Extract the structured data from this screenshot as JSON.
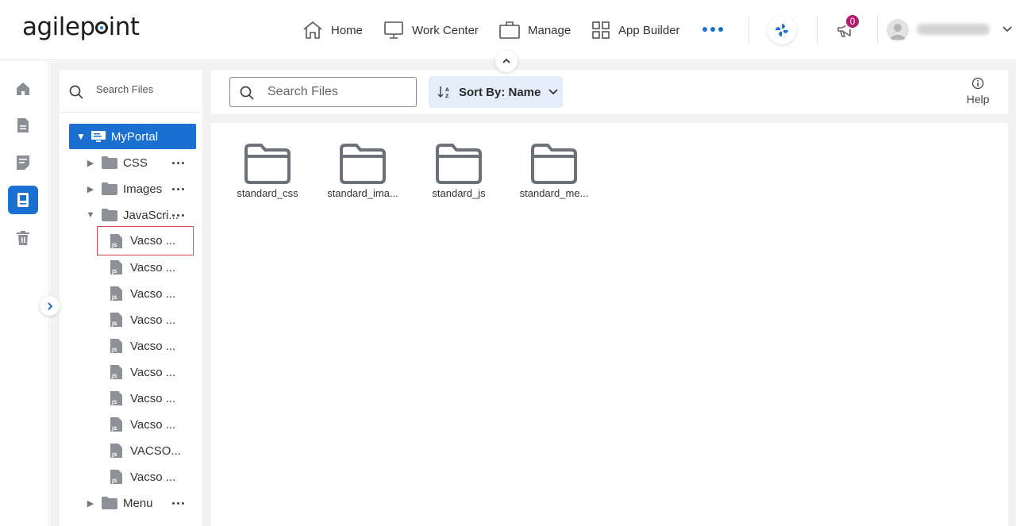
{
  "brand": {
    "logo_prefix": "agilep",
    "logo_suffix": "int"
  },
  "nav": {
    "home": "Home",
    "work_center": "Work Center",
    "manage": "Manage",
    "app_builder": "App Builder"
  },
  "notifications": {
    "count": "0"
  },
  "tree": {
    "search_placeholder": "Search Files",
    "root": "MyPortal",
    "folders": {
      "css": "CSS",
      "images": "Images",
      "javascript": "JavaScri...",
      "menu": "Menu"
    },
    "files": [
      "Vacso ...",
      "Vacso ...",
      "Vacso ...",
      "Vacso ...",
      "Vacso ...",
      "Vacso ...",
      "Vacso ...",
      "Vacso ...",
      "VACSO...",
      "Vacso ..."
    ]
  },
  "toolbar": {
    "search_placeholder": "Search Files",
    "sort_label": "Sort By: Name",
    "help_label": "Help"
  },
  "content": {
    "folders": [
      "standard_css",
      "standard_ima...",
      "standard_js",
      "standard_me..."
    ]
  },
  "colors": {
    "accent": "#1b6fd1",
    "badge": "#b31b6b",
    "sort_bg": "#e4eefb",
    "selection_border": "#d14a4a"
  }
}
